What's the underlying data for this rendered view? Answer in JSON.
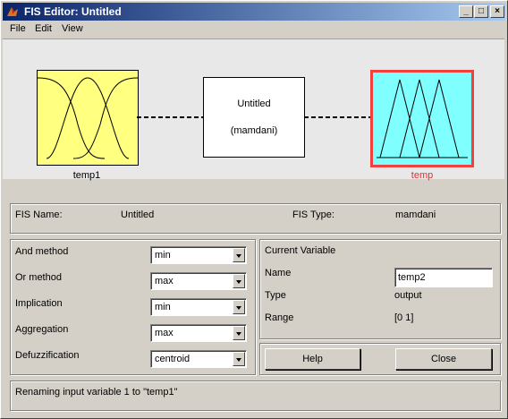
{
  "window": {
    "title": "FIS Editor: Untitled"
  },
  "menu": [
    "File",
    "Edit",
    "View"
  ],
  "diagram": {
    "input": {
      "label": "temp1",
      "color": "#ffff80"
    },
    "system": {
      "name": "Untitled",
      "type": "(mamdani)"
    },
    "output": {
      "label": "temp",
      "color": "#80ffff",
      "label_color": "#e03030",
      "highlight": "#f04040"
    }
  },
  "info": {
    "fis_name_label": "FIS Name:",
    "fis_name": "Untitled",
    "fis_type_label": "FIS Type:",
    "fis_type": "mamdani"
  },
  "methods": [
    {
      "label": "And method",
      "value": "min"
    },
    {
      "label": "Or method",
      "value": "max"
    },
    {
      "label": "Implication",
      "value": "min"
    },
    {
      "label": "Aggregation",
      "value": "max"
    },
    {
      "label": "Defuzzification",
      "value": "centroid"
    }
  ],
  "current_variable": {
    "heading": "Current Variable",
    "name_label": "Name",
    "name_value": "temp2",
    "type_label": "Type",
    "type_value": "output",
    "range_label": "Range",
    "range_value": "[0 1]"
  },
  "buttons": {
    "help": "Help",
    "close": "Close"
  },
  "status": "Renaming input variable 1 to \"temp1\""
}
